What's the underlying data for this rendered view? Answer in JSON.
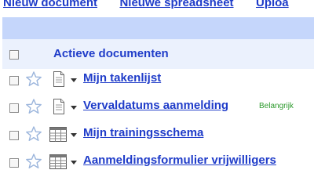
{
  "toolbar": {
    "new_document": "Nieuw document",
    "new_spreadsheet": "Nieuwe spreadsheet",
    "upload": "Uploa"
  },
  "list": {
    "header": "Actieve documenten",
    "rows": [
      {
        "title": "Mijn takenlijst",
        "type": "document",
        "icon": "document-icon",
        "tag": ""
      },
      {
        "title": "Vervaldatums aanmelding",
        "type": "document",
        "icon": "document-icon",
        "tag": "Belangrijk"
      },
      {
        "title": "Mijn trainingsschema",
        "type": "spreadsheet",
        "icon": "spreadsheet-icon",
        "tag": ""
      },
      {
        "title": "Aanmeldingsformulier vrijwilligers",
        "type": "spreadsheet",
        "icon": "spreadsheet-icon",
        "tag": ""
      }
    ]
  },
  "colors": {
    "link": "#1f3cc9",
    "band": "#c5d6fb",
    "header_bg": "#ebf1fd",
    "tag": "#2c9a2c"
  }
}
